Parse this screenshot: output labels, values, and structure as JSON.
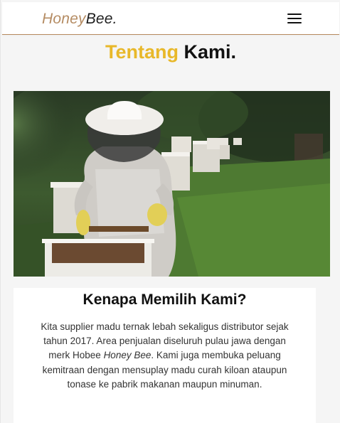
{
  "navbar": {
    "brand_honey": "Honey",
    "brand_bee": "Bee.",
    "menu_icon": "hamburger-menu-icon"
  },
  "heading": {
    "part1": "Tentang",
    "part2": " Kami."
  },
  "hero_image": {
    "subject": "beekeeper",
    "colors": {
      "foliage_dark": "#23331f",
      "foliage_mid": "#3c5a2f",
      "grass": "#4e7a32",
      "suit": "#d8d6d2",
      "glove": "#e2cf57",
      "hive": "#e9e6df"
    }
  },
  "why_us": {
    "title": "Kenapa Memilih Kami?",
    "text_before": "Kita supplier madu ternak lebah sekaligus distributor sejak tahun 2017. Area penjualan diseluruh pulau jawa dengan merk Hobee ",
    "text_italic": "Honey Bee",
    "text_after": ". Kami juga membuka peluang kemitraan dengan mensuplay madu curah kiloan ataupun tonase ke pabrik makanan maupun minuman."
  },
  "colors": {
    "accent_gold": "#e8b82a",
    "brand_brown": "#b58c63",
    "nav_border": "#b78a5e"
  }
}
